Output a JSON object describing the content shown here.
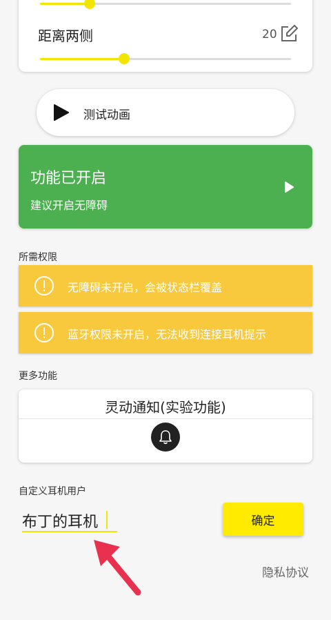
{
  "distance_setting": {
    "label": "距离两侧",
    "value": "20",
    "top_slider_level": 0.2,
    "distance_slider_level": 0.34
  },
  "test_animation": {
    "label": "测试动画"
  },
  "status_card": {
    "title": "功能已开启",
    "subtitle": "建议开启无障碍",
    "color": "#4caf50"
  },
  "permissions": {
    "section_label": "所需权限",
    "items": [
      {
        "text": "无障碍未开启，会被状态栏覆盖"
      },
      {
        "text": "蓝牙权限未开启，无法收到连接耳机提示"
      }
    ],
    "warn_color": "#f9c93d"
  },
  "more_features": {
    "section_label": "更多功能",
    "dynamic_notification": {
      "title": "灵动通知(实验功能)"
    }
  },
  "custom_user": {
    "section_label": "自定义耳机用户",
    "input_value": "布丁的耳机",
    "confirm_label": "确定"
  },
  "footer": {
    "privacy_label": "隐私协议"
  },
  "colors": {
    "accent": "#f2e600",
    "button": "#ffeb00",
    "arrow": "#e8304f"
  }
}
